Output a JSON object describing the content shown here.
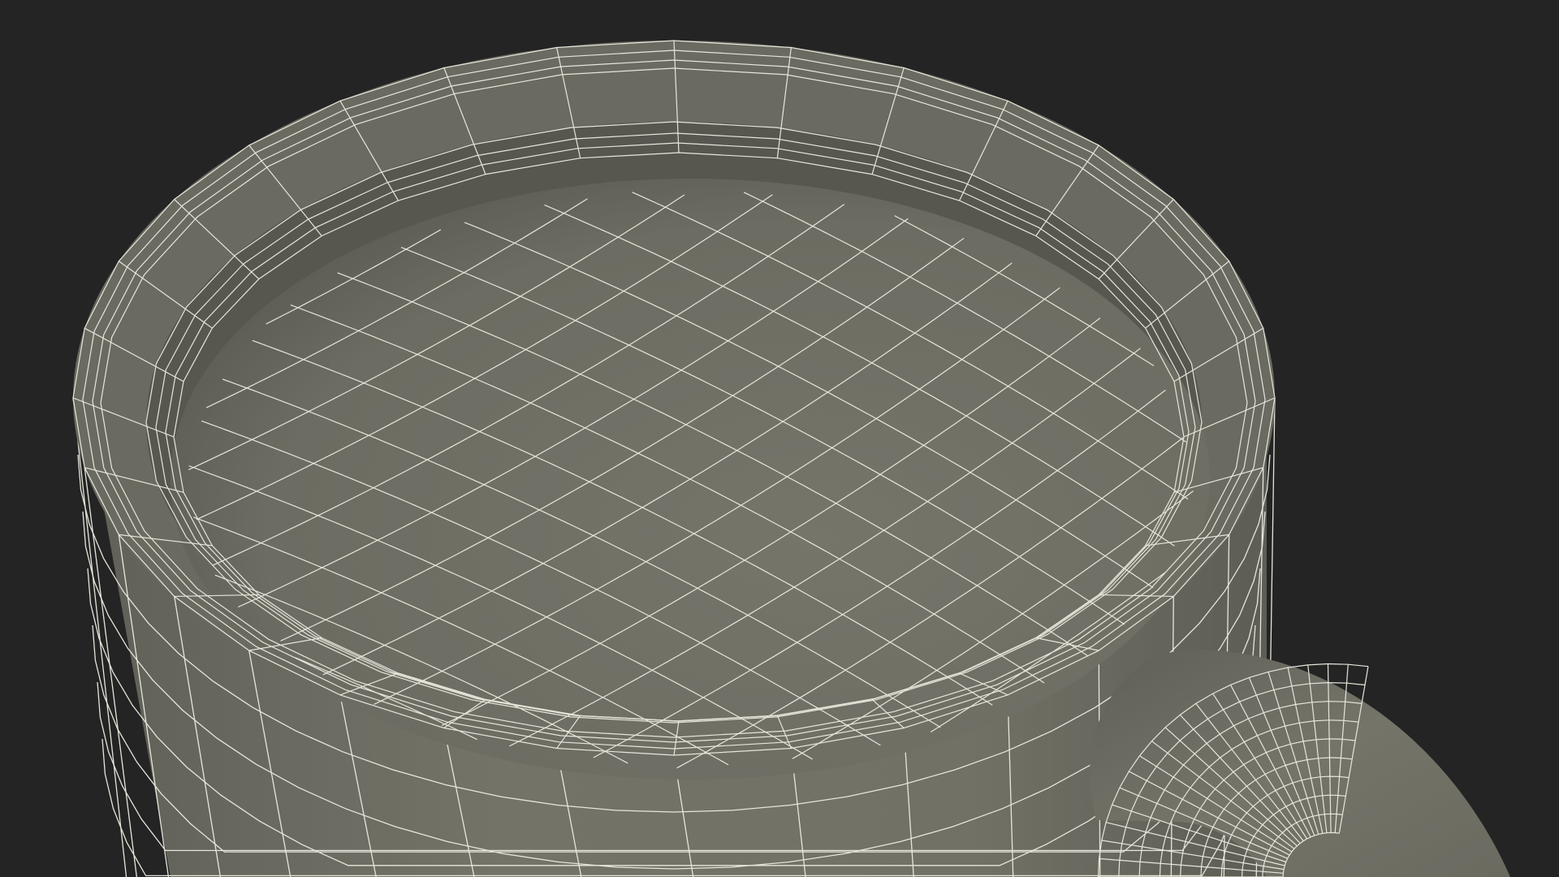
{
  "scene": {
    "subject": "mug-wireframe",
    "colors": {
      "background": "#242424",
      "surface": "#6f6f64",
      "surface_dark": "#5a5a52",
      "inner_wall": "#55554d",
      "wire": "#e6e6dc"
    }
  }
}
